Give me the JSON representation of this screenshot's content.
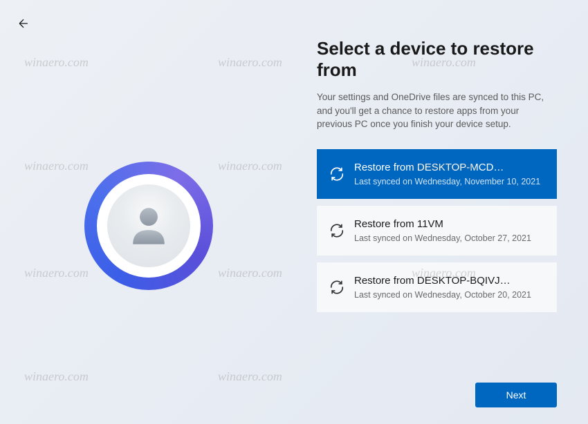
{
  "header": {
    "title": "Select a device to restore from",
    "description": "Your settings and OneDrive files are synced to this PC, and you'll get a chance to restore apps from your previous PC once you finish your device setup."
  },
  "devices": [
    {
      "title": "Restore from DESKTOP-MCD…",
      "subtitle": "Last synced on Wednesday, November 10, 2021",
      "selected": true
    },
    {
      "title": "Restore from 11VM",
      "subtitle": "Last synced on Wednesday, October 27, 2021",
      "selected": false
    },
    {
      "title": "Restore from DESKTOP-BQIVJ…",
      "subtitle": "Last synced on Wednesday, October 20, 2021",
      "selected": false
    }
  ],
  "footer": {
    "next_label": "Next"
  },
  "watermark_text": "winaero.com"
}
